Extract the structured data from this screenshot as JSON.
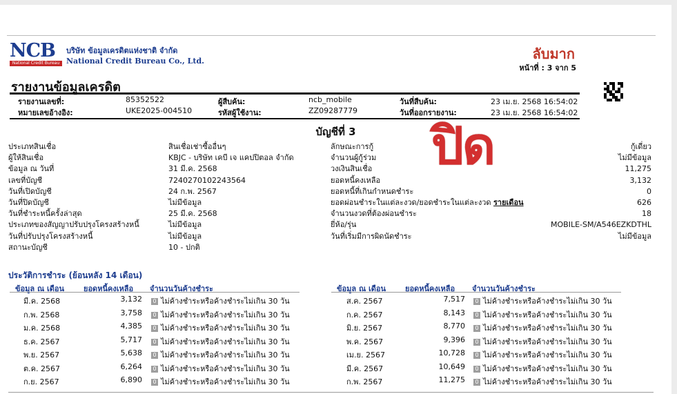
{
  "header": {
    "logo_text": "NCB",
    "logo_sub": "National Credit Bureau",
    "company_th": "บริษัท ข้อมูลเครดิตแห่งชาติ จำกัด",
    "company_en": "National Credit Bureau Co., Ltd.",
    "confidential": "ลับมาก",
    "page_label": "หน้าที่ :",
    "page_current": "3",
    "page_of": "จาก",
    "page_total": "5",
    "report_title": "รายงานข้อมูลเครดิต"
  },
  "report_meta": {
    "report_no_label": "รายงานเลขที่:",
    "report_no": "85352522",
    "ref_no_label": "หมายเลขอ้างอิง:",
    "ref_no": "UKE2025-004510",
    "inquirer_label": "ผู้สืบค้น:",
    "inquirer": "ncb_mobile",
    "user_code_label": "รหัสผู้ใช้งาน:",
    "user_code": "ZZ09287779",
    "inquiry_date_label": "วันที่สืบค้น:",
    "inquiry_date": "23 เม.ย. 2568 16:54:02",
    "report_date_label": "วันที่ออกรายงาน:",
    "report_date": "23 เม.ย. 2568 16:54:02"
  },
  "account": {
    "title": "บัญชีที่ 3",
    "stamp": "ปิด",
    "left": [
      {
        "label": "ประเภทสินเชื่อ",
        "value": "สินเชื่อเช่าซื้ออื่นๆ"
      },
      {
        "label": "ผู้ให้สินเชื่อ",
        "value": "KBJC - บริษัท เคบี เจ แคปปิตอล จำกัด"
      },
      {
        "label": "ข้อมูล ณ วันที่",
        "value": "31 มี.ค. 2568"
      },
      {
        "label": "เลขที่บัญชี",
        "value": "7240270102243564"
      },
      {
        "label": "วันที่เปิดบัญชี",
        "value": "24 ก.พ. 2567"
      },
      {
        "label": "วันที่ปิดบัญชี",
        "value": "ไม่มีข้อมูล"
      },
      {
        "label": "วันที่ชำระหนี้ครั้งล่าสุด",
        "value": "25 มี.ค. 2568"
      },
      {
        "label": "ประเภทของสัญญาปรับปรุงโครงสร้างหนี้",
        "value": "ไม่มีข้อมูล"
      },
      {
        "label": "วันที่ปรับปรุงโครงสร้างหนี้",
        "value": "ไม่มีข้อมูล"
      },
      {
        "label": "สถานะบัญชี",
        "value": "10 - ปกติ"
      }
    ],
    "right": [
      {
        "label": "ลักษณะการกู้",
        "value": "กู้เดี่ยว"
      },
      {
        "label": "จำนวนผู้กู้ร่วม",
        "value": "ไม่มีข้อมูล"
      },
      {
        "label": "วงเงินสินเชื่อ",
        "value": "11,275"
      },
      {
        "label": "ยอดหนี้คงเหลือ",
        "value": "3,132"
      },
      {
        "label": "ยอดหนี้ที่เกินกำหนดชำระ",
        "value": "0"
      },
      {
        "label": "ยอดผ่อนชำระในแต่ละงวด/ยอดชำระในแต่ละงวด",
        "extra": "รายเดือน",
        "value": "626"
      },
      {
        "label": "จำนวนงวดที่ต้องผ่อนชำระ",
        "value": "18"
      },
      {
        "label": "ยี่ห้อ/รุ่น",
        "value": "MOBILE-SM/A546EZKDTHL"
      },
      {
        "label": "วันที่เริ่มมีการผิดนัดชำระ",
        "value": "ไม่มีข้อมูล"
      }
    ]
  },
  "history": {
    "title": "ประวัติการชำระ (ย้อนหลัง 14 เดือน)",
    "col_month": "ข้อมูล ณ เดือน",
    "col_balance": "ยอดหนี้คงเหลือ",
    "col_days": "จำนวนวันค้างชำระ",
    "left": [
      {
        "month": "มี.ค. 2568",
        "balance": "3,132",
        "code": "0",
        "status": "ไม่ค้างชำระหรือค้างชำระไม่เกิน 30 วัน"
      },
      {
        "month": "ก.พ. 2568",
        "balance": "3,758",
        "code": "0",
        "status": "ไม่ค้างชำระหรือค้างชำระไม่เกิน 30 วัน"
      },
      {
        "month": "ม.ค. 2568",
        "balance": "4,385",
        "code": "0",
        "status": "ไม่ค้างชำระหรือค้างชำระไม่เกิน 30 วัน"
      },
      {
        "month": "ธ.ค. 2567",
        "balance": "5,717",
        "code": "0",
        "status": "ไม่ค้างชำระหรือค้างชำระไม่เกิน 30 วัน"
      },
      {
        "month": "พ.ย. 2567",
        "balance": "5,638",
        "code": "0",
        "status": "ไม่ค้างชำระหรือค้างชำระไม่เกิน 30 วัน"
      },
      {
        "month": "ต.ค. 2567",
        "balance": "6,264",
        "code": "0",
        "status": "ไม่ค้างชำระหรือค้างชำระไม่เกิน 30 วัน"
      },
      {
        "month": "ก.ย. 2567",
        "balance": "6,890",
        "code": "0",
        "status": "ไม่ค้างชำระหรือค้างชำระไม่เกิน 30 วัน"
      }
    ],
    "right": [
      {
        "month": "ส.ค. 2567",
        "balance": "7,517",
        "code": "0",
        "status": "ไม่ค้างชำระหรือค้างชำระไม่เกิน 30 วัน"
      },
      {
        "month": "ก.ค. 2567",
        "balance": "8,143",
        "code": "0",
        "status": "ไม่ค้างชำระหรือค้างชำระไม่เกิน 30 วัน"
      },
      {
        "month": "มิ.ย. 2567",
        "balance": "8,770",
        "code": "0",
        "status": "ไม่ค้างชำระหรือค้างชำระไม่เกิน 30 วัน"
      },
      {
        "month": "พ.ค. 2567",
        "balance": "9,396",
        "code": "0",
        "status": "ไม่ค้างชำระหรือค้างชำระไม่เกิน 30 วัน"
      },
      {
        "month": "เม.ย. 2567",
        "balance": "10,728",
        "code": "0",
        "status": "ไม่ค้างชำระหรือค้างชำระไม่เกิน 30 วัน"
      },
      {
        "month": "มี.ค. 2567",
        "balance": "10,649",
        "code": "0",
        "status": "ไม่ค้างชำระหรือค้างชำระไม่เกิน 30 วัน"
      },
      {
        "month": "ก.พ. 2567",
        "balance": "11,275",
        "code": "0",
        "status": "ไม่ค้างชำระหรือค้างชำระไม่เกิน 30 วัน"
      }
    ]
  }
}
